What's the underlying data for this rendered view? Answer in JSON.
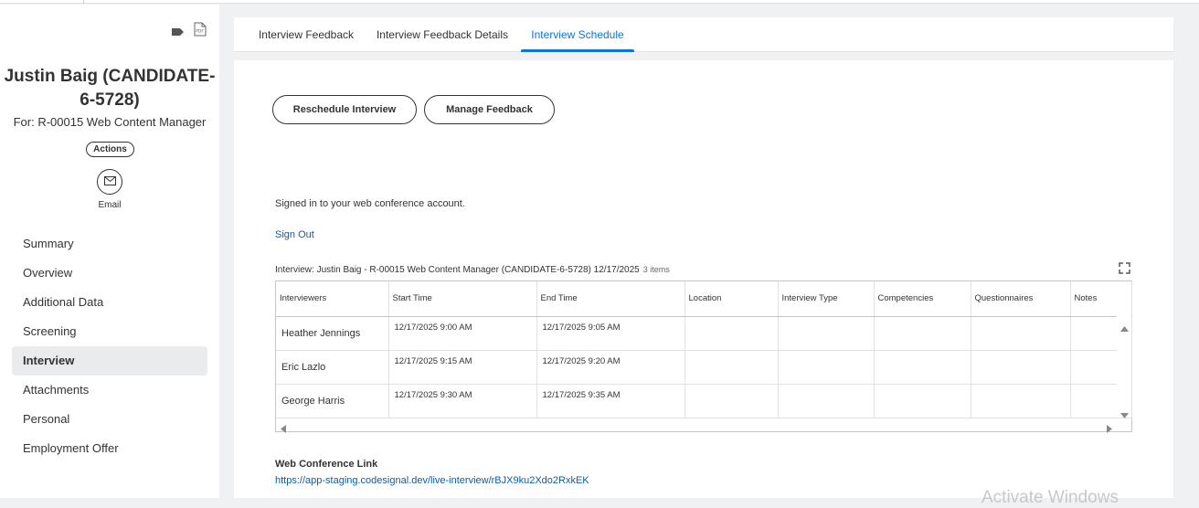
{
  "candidate": {
    "name": "Justin Baig (CANDIDATE-6-5728)",
    "for": "For: R-00015 Web Content Manager",
    "actions_label": "Actions",
    "email_label": "Email"
  },
  "nav": {
    "items": [
      {
        "label": "Summary"
      },
      {
        "label": "Overview"
      },
      {
        "label": "Additional Data"
      },
      {
        "label": "Screening"
      },
      {
        "label": "Interview",
        "active": true
      },
      {
        "label": "Attachments"
      },
      {
        "label": "Personal"
      },
      {
        "label": "Employment Offer"
      }
    ]
  },
  "tabs": [
    {
      "label": "Interview Feedback"
    },
    {
      "label": "Interview Feedback Details"
    },
    {
      "label": "Interview Schedule",
      "active": true
    }
  ],
  "buttons": {
    "reschedule": "Reschedule Interview",
    "manage_feedback": "Manage Feedback"
  },
  "conference": {
    "signed_in_text": "Signed in to your web conference account.",
    "sign_out": "Sign Out",
    "link_label": "Web Conference Link",
    "link_url": "https://app-staging.codesignal.dev/live-interview/rBJX9ku2Xdo2RxkEK"
  },
  "grid": {
    "title": "Interview: Justin Baig - R-00015 Web Content Manager (CANDIDATE-6-5728) 12/17/2025",
    "count": "3 items",
    "columns": [
      "Interviewers",
      "Start Time",
      "End Time",
      "Location",
      "Interview Type",
      "Competencies",
      "Questionnaires",
      "Notes"
    ],
    "rows": [
      [
        "Heather Jennings",
        "12/17/2025 9:00 AM",
        "12/17/2025 9:05 AM",
        "",
        "",
        "",
        "",
        ""
      ],
      [
        "Eric Lazlo",
        "12/17/2025 9:15 AM",
        "12/17/2025 9:20 AM",
        "",
        "",
        "",
        "",
        ""
      ],
      [
        "George Harris",
        "12/17/2025 9:30 AM",
        "12/17/2025 9:35 AM",
        "",
        "",
        "",
        "",
        ""
      ]
    ]
  },
  "watermark": "Activate Windows",
  "colors": {
    "accent": "#0875e1",
    "link": "#0b5cab",
    "nav_active_bg": "#eaebec",
    "page_bg": "#f0f1f2"
  }
}
